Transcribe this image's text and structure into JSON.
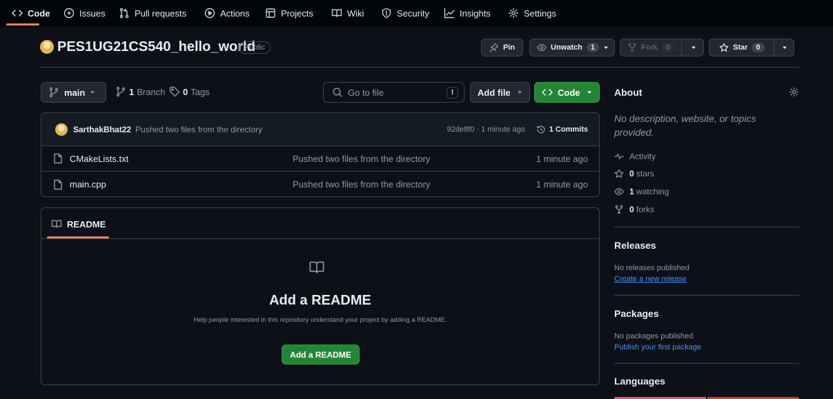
{
  "nav": {
    "code": "Code",
    "issues": "Issues",
    "pulls": "Pull requests",
    "actions": "Actions",
    "projects": "Projects",
    "wiki": "Wiki",
    "security": "Security",
    "insights": "Insights",
    "settings": "Settings"
  },
  "repo": {
    "name": "PES1UG21CS540_hello_world",
    "visibility": "Public",
    "pin": "Pin",
    "unwatch": "Unwatch",
    "watch_count": "1",
    "fork": "Fork",
    "fork_count": "0",
    "star": "Star",
    "star_count": "0"
  },
  "toolbar": {
    "branch": "main",
    "branch_count": "1",
    "branch_label": "Branch",
    "tag_count": "0",
    "tag_label": "Tags",
    "go_to_file": "Go to file",
    "shortcut": "t",
    "add_file": "Add file",
    "code": "Code"
  },
  "commit": {
    "author": "SarthakBhat22",
    "message": "Pushed two files from the directory",
    "meta": "92de8f0 · 1 minute ago",
    "commits": "1 Commits"
  },
  "files": [
    {
      "name": "CMakeLists.txt",
      "message": "Pushed two files from the directory",
      "time": "1 minute ago",
      "icon": "file-icon"
    },
    {
      "name": "main.cpp",
      "message": "Pushed two files from the directory",
      "time": "1 minute ago",
      "icon": "file-icon"
    }
  ],
  "readme": {
    "tab": "README",
    "heading": "Add a README",
    "description": "Help people interested in this repository understand your project by adding a README.",
    "button": "Add a README"
  },
  "sidebar": {
    "about": "About",
    "description": "No description, website, or topics provided.",
    "activity": "Activity",
    "stars_count": "0",
    "stars_label": "stars",
    "watching_count": "1",
    "watching_label": "watching",
    "forks_count": "0",
    "forks_label": "forks",
    "releases": "Releases",
    "no_releases": "No releases published",
    "create_release": "Create a new release",
    "packages": "Packages",
    "no_packages": "No packages published",
    "publish_package": "Publish your first package",
    "languages": "Languages"
  },
  "colors": {
    "accent": "#f78166",
    "green": "#238636",
    "link": "#4493f8",
    "language_bar_1": "#f34b7d",
    "language_bar_2": "#da3434"
  }
}
